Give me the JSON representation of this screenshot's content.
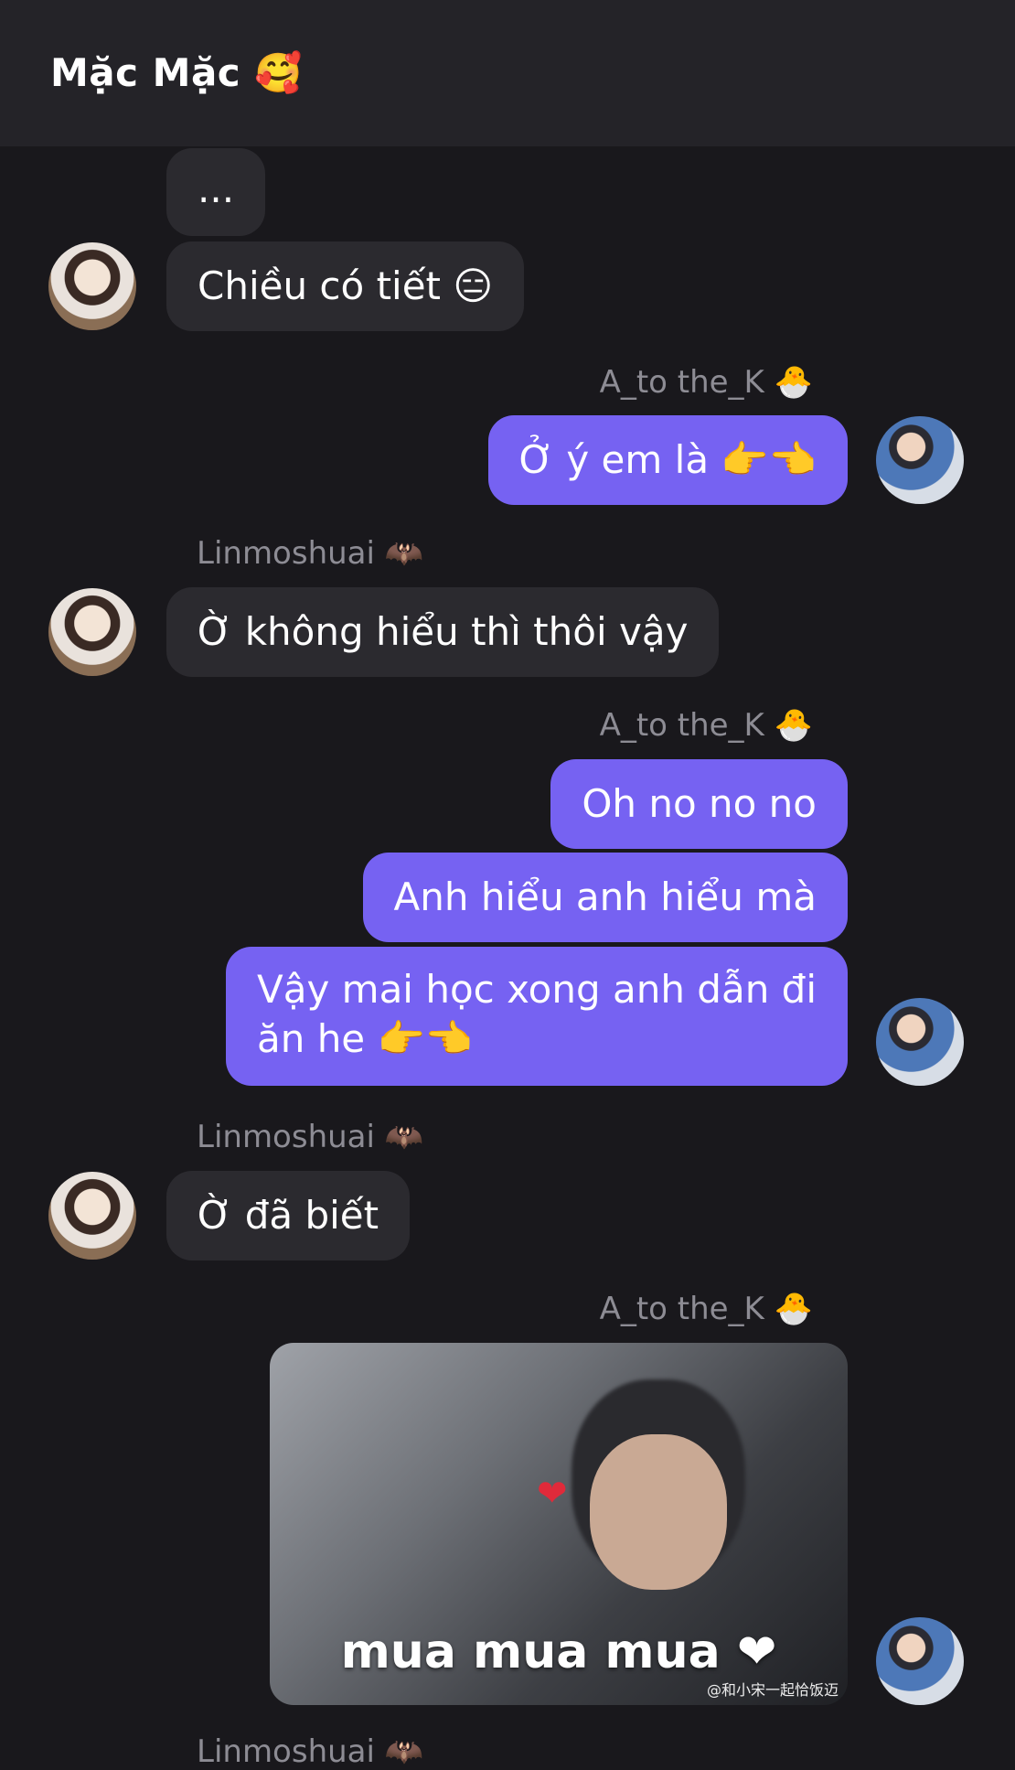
{
  "header": {
    "title": "Mặc Mặc 🥰"
  },
  "messages": {
    "m0": "...",
    "m1": "Chiều có tiết 😑",
    "n2": "A_to the_K 🐣",
    "m2": "Ở ý em là 👉👈",
    "n3": "Linmoshuai 🦇",
    "m3": "Ờ không hiểu thì thôi vậy",
    "n4": "A_to the_K 🐣",
    "m4a": "Oh no no no",
    "m4b": "Anh hiểu anh hiểu mà",
    "m4c_line1": "Vậy mai học xong anh dẫn đi",
    "m4c_line2": "ăn he 👉👈",
    "n5": "Linmoshuai 🦇",
    "m5": "Ờ đã biết",
    "n6": "A_to the_K 🐣",
    "media_caption": "mua mua mua ❤",
    "media_watermark": "@和小宋一起恰饭迈",
    "n7": "Linmoshuai 🦇"
  },
  "colors": {
    "background": "#19181c",
    "header": "#242328",
    "incoming": "#2b2a2f",
    "outgoing": "#7662f2"
  }
}
